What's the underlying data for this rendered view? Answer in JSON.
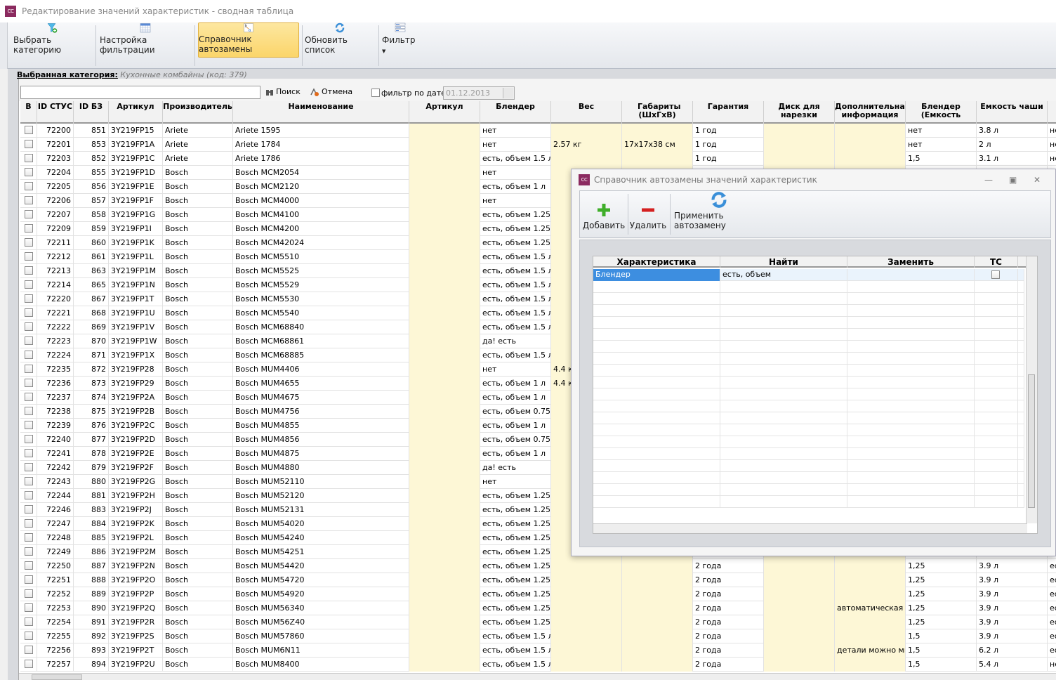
{
  "window": {
    "title": "Редактирование значений характеристик - сводная таблица",
    "icon": "CC"
  },
  "toolbar": {
    "select_category": "Выбрать категорию",
    "filter_settings": "Настройка фильтрации",
    "autoreplace_dict": "Справочник автозамены",
    "refresh_list": "Обновить список",
    "filter": "Фильтр"
  },
  "category": {
    "label": "Выбранная категория:",
    "value": "Кухонные комбайны (код: 379)"
  },
  "search": {
    "value": "",
    "search_label": "Поиск",
    "cancel_label": "Отмена",
    "date_filter_label": "фильтр по дате",
    "date_value": "01.12.2013"
  },
  "columns": [
    "В",
    "ID СТУС",
    "ID БЗ",
    "Артикул",
    "Производитель",
    "Наименование",
    "Артикул",
    "Блендер",
    "Вес",
    "Габариты (ШхГхВ)",
    "Гарантия",
    "Диск для нарезки",
    "Дополнительная информация",
    "Блендер (Емкость",
    "Емкость чаши"
  ],
  "rows": [
    {
      "stus": "72200",
      "bz": "851",
      "art": "3Y219FP15",
      "mfr": "Ariete",
      "name": "Ariete 1595",
      "blender": "нет",
      "weight": "",
      "dims": "",
      "warranty": "1 год",
      "info": "",
      "bcap": "нет",
      "bowl": "3.8 л",
      "extra": "не"
    },
    {
      "stus": "72201",
      "bz": "853",
      "art": "3Y219FP1A",
      "mfr": "Ariete",
      "name": "Ariete 1784",
      "blender": "нет",
      "weight": "2.57 кг",
      "dims": "17x17x38 см",
      "warranty": "1 год",
      "info": "",
      "bcap": "нет",
      "bowl": "2 л",
      "extra": "не"
    },
    {
      "stus": "72203",
      "bz": "852",
      "art": "3Y219FP1C",
      "mfr": "Ariete",
      "name": "Ariete 1786",
      "blender": "есть, объем 1.5 л",
      "weight": "",
      "dims": "",
      "warranty": "1 год",
      "info": "",
      "bcap": "1,5",
      "bowl": "3.1 л",
      "extra": "не"
    },
    {
      "stus": "72204",
      "bz": "855",
      "art": "3Y219FP1D",
      "mfr": "Bosch",
      "name": "Bosch MCM2054",
      "blender": "нет",
      "weight": "",
      "dims": "",
      "warranty": "",
      "info": "",
      "bcap": "",
      "bowl": "",
      "extra": ""
    },
    {
      "stus": "72205",
      "bz": "856",
      "art": "3Y219FP1E",
      "mfr": "Bosch",
      "name": "Bosch MCM2120",
      "blender": "есть, объем 1 л",
      "weight": "",
      "dims": "",
      "warranty": "",
      "info": "",
      "bcap": "",
      "bowl": "",
      "extra": ""
    },
    {
      "stus": "72206",
      "bz": "857",
      "art": "3Y219FP1F",
      "mfr": "Bosch",
      "name": "Bosch MCM4000",
      "blender": "нет",
      "weight": "",
      "dims": "",
      "warranty": "",
      "info": "",
      "bcap": "",
      "bowl": "",
      "extra": ""
    },
    {
      "stus": "72207",
      "bz": "858",
      "art": "3Y219FP1G",
      "mfr": "Bosch",
      "name": "Bosch MCM4100",
      "blender": "есть, объем 1.25 л",
      "weight": "",
      "dims": "",
      "warranty": "",
      "info": "",
      "bcap": "",
      "bowl": "",
      "extra": ""
    },
    {
      "stus": "72209",
      "bz": "859",
      "art": "3Y219FP1I",
      "mfr": "Bosch",
      "name": "Bosch MCM4200",
      "blender": "есть, объем 1.25 л",
      "weight": "",
      "dims": "",
      "warranty": "",
      "info": "",
      "bcap": "",
      "bowl": "",
      "extra": ""
    },
    {
      "stus": "72211",
      "bz": "860",
      "art": "3Y219FP1K",
      "mfr": "Bosch",
      "name": "Bosch MCM42024",
      "blender": "есть, объем 1.25 л",
      "weight": "",
      "dims": "",
      "warranty": "",
      "info": "",
      "bcap": "",
      "bowl": "",
      "extra": ""
    },
    {
      "stus": "72212",
      "bz": "861",
      "art": "3Y219FP1L",
      "mfr": "Bosch",
      "name": "Bosch MCM5510",
      "blender": "есть, объем 1.5 л",
      "weight": "",
      "dims": "",
      "warranty": "",
      "info": "",
      "bcap": "",
      "bowl": "",
      "extra": ""
    },
    {
      "stus": "72213",
      "bz": "863",
      "art": "3Y219FP1M",
      "mfr": "Bosch",
      "name": "Bosch MCM5525",
      "blender": "есть, объем 1.5 л",
      "weight": "",
      "dims": "",
      "warranty": "",
      "info": "",
      "bcap": "",
      "bowl": "",
      "extra": ""
    },
    {
      "stus": "72214",
      "bz": "865",
      "art": "3Y219FP1N",
      "mfr": "Bosch",
      "name": "Bosch MCM5529",
      "blender": "есть, объем 1.5 л",
      "weight": "",
      "dims": "",
      "warranty": "",
      "info": "",
      "bcap": "",
      "bowl": "",
      "extra": ""
    },
    {
      "stus": "72220",
      "bz": "867",
      "art": "3Y219FP1T",
      "mfr": "Bosch",
      "name": "Bosch MCM5530",
      "blender": "есть, объем 1.5 л",
      "weight": "",
      "dims": "",
      "warranty": "",
      "info": "",
      "bcap": "",
      "bowl": "",
      "extra": ""
    },
    {
      "stus": "72221",
      "bz": "868",
      "art": "3Y219FP1U",
      "mfr": "Bosch",
      "name": "Bosch MCM5540",
      "blender": "есть, объем 1.5 л",
      "weight": "",
      "dims": "",
      "warranty": "",
      "info": "",
      "bcap": "",
      "bowl": "",
      "extra": ""
    },
    {
      "stus": "72222",
      "bz": "869",
      "art": "3Y219FP1V",
      "mfr": "Bosch",
      "name": "Bosch MCM68840",
      "blender": "есть, объем 1.5 л",
      "weight": "",
      "dims": "",
      "warranty": "",
      "info": "",
      "bcap": "",
      "bowl": "",
      "extra": ""
    },
    {
      "stus": "72223",
      "bz": "870",
      "art": "3Y219FP1W",
      "mfr": "Bosch",
      "name": "Bosch MCM68861",
      "blender": "да! есть",
      "weight": "",
      "dims": "",
      "warranty": "",
      "info": "",
      "bcap": "",
      "bowl": "",
      "extra": ""
    },
    {
      "stus": "72224",
      "bz": "871",
      "art": "3Y219FP1X",
      "mfr": "Bosch",
      "name": "Bosch MCM68885",
      "blender": "есть, объем 1.5 л",
      "weight": "",
      "dims": "",
      "warranty": "",
      "info": "",
      "bcap": "",
      "bowl": "",
      "extra": ""
    },
    {
      "stus": "72235",
      "bz": "872",
      "art": "3Y219FP28",
      "mfr": "Bosch",
      "name": "Bosch MUM4406",
      "blender": "нет",
      "weight": "4.4 к",
      "dims": "",
      "warranty": "",
      "info": "",
      "bcap": "",
      "bowl": "",
      "extra": ""
    },
    {
      "stus": "72236",
      "bz": "873",
      "art": "3Y219FP29",
      "mfr": "Bosch",
      "name": "Bosch MUM4655",
      "blender": "есть, объем 1 л",
      "weight": "4.4 к",
      "dims": "",
      "warranty": "",
      "info": "",
      "bcap": "",
      "bowl": "",
      "extra": ""
    },
    {
      "stus": "72237",
      "bz": "874",
      "art": "3Y219FP2A",
      "mfr": "Bosch",
      "name": "Bosch MUM4675",
      "blender": "есть, объем 1 л",
      "weight": "",
      "dims": "",
      "warranty": "",
      "info": "",
      "bcap": "",
      "bowl": "",
      "extra": ""
    },
    {
      "stus": "72238",
      "bz": "875",
      "art": "3Y219FP2B",
      "mfr": "Bosch",
      "name": "Bosch MUM4756",
      "blender": "есть, объем 0.75 л",
      "weight": "",
      "dims": "",
      "warranty": "",
      "info": "",
      "bcap": "",
      "bowl": "",
      "extra": ""
    },
    {
      "stus": "72239",
      "bz": "876",
      "art": "3Y219FP2C",
      "mfr": "Bosch",
      "name": "Bosch MUM4855",
      "blender": "есть, объем 1 л",
      "weight": "",
      "dims": "",
      "warranty": "",
      "info": "",
      "bcap": "",
      "bowl": "",
      "extra": ""
    },
    {
      "stus": "72240",
      "bz": "877",
      "art": "3Y219FP2D",
      "mfr": "Bosch",
      "name": "Bosch MUM4856",
      "blender": "есть, объем 0.75 л",
      "weight": "",
      "dims": "",
      "warranty": "",
      "info": "",
      "bcap": "",
      "bowl": "",
      "extra": ""
    },
    {
      "stus": "72241",
      "bz": "878",
      "art": "3Y219FP2E",
      "mfr": "Bosch",
      "name": "Bosch MUM4875",
      "blender": "есть, объем 1 л",
      "weight": "",
      "dims": "",
      "warranty": "",
      "info": "",
      "bcap": "",
      "bowl": "",
      "extra": ""
    },
    {
      "stus": "72242",
      "bz": "879",
      "art": "3Y219FP2F",
      "mfr": "Bosch",
      "name": "Bosch MUM4880",
      "blender": "да! есть",
      "weight": "",
      "dims": "",
      "warranty": "",
      "info": "",
      "bcap": "",
      "bowl": "",
      "extra": ""
    },
    {
      "stus": "72243",
      "bz": "880",
      "art": "3Y219FP2G",
      "mfr": "Bosch",
      "name": "Bosch MUM52110",
      "blender": "нет",
      "weight": "",
      "dims": "",
      "warranty": "",
      "info": "",
      "bcap": "",
      "bowl": "",
      "extra": ""
    },
    {
      "stus": "72244",
      "bz": "881",
      "art": "3Y219FP2H",
      "mfr": "Bosch",
      "name": "Bosch MUM52120",
      "blender": "есть, объем 1.25 л",
      "weight": "",
      "dims": "",
      "warranty": "",
      "info": "",
      "bcap": "",
      "bowl": "",
      "extra": ""
    },
    {
      "stus": "72246",
      "bz": "883",
      "art": "3Y219FP2J",
      "mfr": "Bosch",
      "name": "Bosch MUM52131",
      "blender": "есть, объем 1.25 л",
      "weight": "",
      "dims": "",
      "warranty": "",
      "info": "",
      "bcap": "",
      "bowl": "",
      "extra": ""
    },
    {
      "stus": "72247",
      "bz": "884",
      "art": "3Y219FP2K",
      "mfr": "Bosch",
      "name": "Bosch MUM54020",
      "blender": "есть, объем 1.25 л",
      "weight": "",
      "dims": "",
      "warranty": "",
      "info": "",
      "bcap": "",
      "bowl": "",
      "extra": ""
    },
    {
      "stus": "72248",
      "bz": "885",
      "art": "3Y219FP2L",
      "mfr": "Bosch",
      "name": "Bosch MUM54240",
      "blender": "есть, объем 1.25 л",
      "weight": "",
      "dims": "",
      "warranty": "",
      "info": "",
      "bcap": "",
      "bowl": "",
      "extra": ""
    },
    {
      "stus": "72249",
      "bz": "886",
      "art": "3Y219FP2M",
      "mfr": "Bosch",
      "name": "Bosch MUM54251",
      "blender": "есть, объем 1.25 л",
      "weight": "",
      "dims": "",
      "warranty": "",
      "info": "",
      "bcap": "",
      "bowl": "",
      "extra": ""
    },
    {
      "stus": "72250",
      "bz": "887",
      "art": "3Y219FP2N",
      "mfr": "Bosch",
      "name": "Bosch MUM54420",
      "blender": "есть, объем 1.25 л",
      "weight": "",
      "dims": "",
      "warranty": "2 года",
      "info": "",
      "bcap": "1,25",
      "bowl": "3.9 л",
      "extra": "ес"
    },
    {
      "stus": "72251",
      "bz": "888",
      "art": "3Y219FP2O",
      "mfr": "Bosch",
      "name": "Bosch MUM54720",
      "blender": "есть, объем 1.25 л",
      "weight": "",
      "dims": "",
      "warranty": "2 года",
      "info": "",
      "bcap": "1,25",
      "bowl": "3.9 л",
      "extra": "ес"
    },
    {
      "stus": "72252",
      "bz": "889",
      "art": "3Y219FP2P",
      "mfr": "Bosch",
      "name": "Bosch MUM54920",
      "blender": "есть, объем 1.25 л",
      "weight": "",
      "dims": "",
      "warranty": "2 года",
      "info": "",
      "bcap": "1,25",
      "bowl": "3.9 л",
      "extra": "ес"
    },
    {
      "stus": "72253",
      "bz": "890",
      "art": "3Y219FP2Q",
      "mfr": "Bosch",
      "name": "Bosch MUM56340",
      "blender": "есть, объем 1.25 л",
      "weight": "",
      "dims": "",
      "warranty": "2 года",
      "info": "автоматическая на",
      "bcap": "1,25",
      "bowl": "3.9 л",
      "extra": "ес"
    },
    {
      "stus": "72254",
      "bz": "891",
      "art": "3Y219FP2R",
      "mfr": "Bosch",
      "name": "Bosch MUM56Z40",
      "blender": "есть, объем 1.25 л",
      "weight": "",
      "dims": "",
      "warranty": "2 года",
      "info": "",
      "bcap": "1,25",
      "bowl": "3.9 л",
      "extra": "ес"
    },
    {
      "stus": "72255",
      "bz": "892",
      "art": "3Y219FP2S",
      "mfr": "Bosch",
      "name": "Bosch MUM57860",
      "blender": "есть, объем 1.5 л",
      "weight": "",
      "dims": "",
      "warranty": "2 года",
      "info": "",
      "bcap": "1,5",
      "bowl": "3.9 л",
      "extra": "ес"
    },
    {
      "stus": "72256",
      "bz": "893",
      "art": "3Y219FP2T",
      "mfr": "Bosch",
      "name": "Bosch MUM6N11",
      "blender": "есть, объем 1.5 л",
      "weight": "",
      "dims": "",
      "warranty": "2 года",
      "info": "детали можно мыть",
      "bcap": "1,5",
      "bowl": "6.2 л",
      "extra": "ес"
    },
    {
      "stus": "72257",
      "bz": "894",
      "art": "3Y219FP2U",
      "mfr": "Bosch",
      "name": "Bosch MUM8400",
      "blender": "есть, объем 1.5 л",
      "weight": "",
      "dims": "",
      "warranty": "2 года",
      "info": "",
      "bcap": "1,5",
      "bowl": "5.4 л",
      "extra": "не"
    }
  ],
  "dialog": {
    "title": "Справочник автозамены значений характеристик",
    "add_label": "Добавить",
    "delete_label": "Удалить",
    "apply_label": "Применить автозамену",
    "columns": [
      "Характеристика",
      "Найти",
      "Заменить",
      "ТС"
    ],
    "rows": [
      {
        "feature": "Блендер",
        "find": "есть, объем",
        "replace": ""
      }
    ]
  },
  "colors": {
    "editable_cell": "#fdf7d6",
    "active_button": "#fbd56a",
    "selected_row": "#cfe4fa"
  }
}
